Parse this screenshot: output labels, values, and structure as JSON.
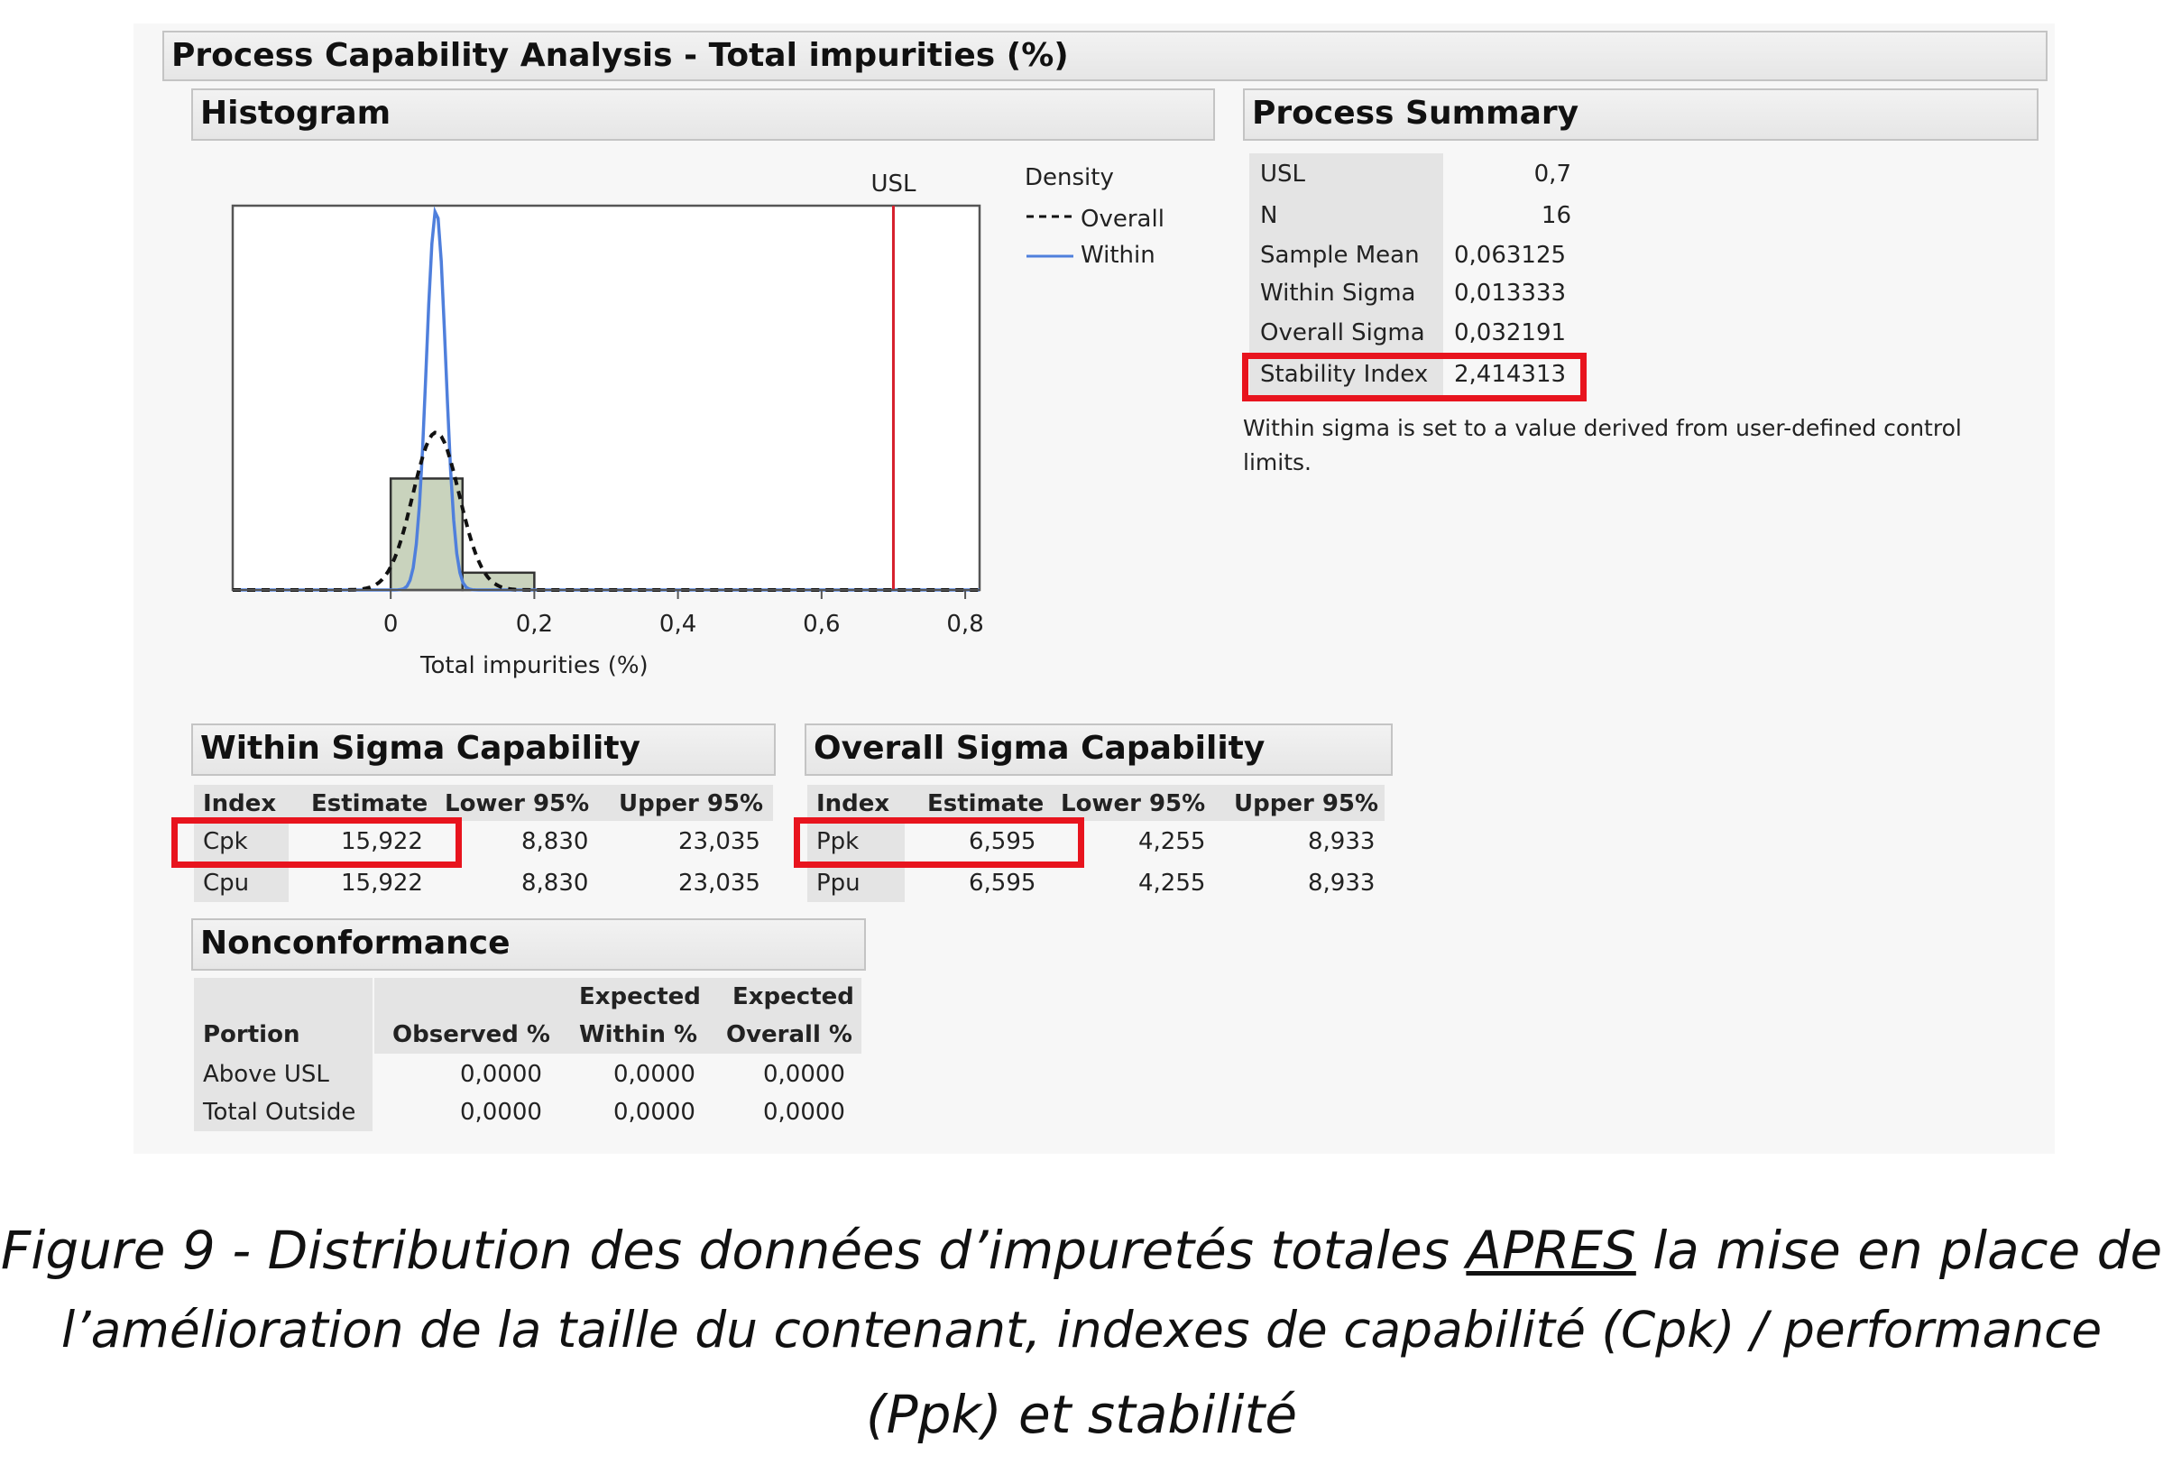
{
  "window_title": "Process Capability Analysis - Total impurities (%)",
  "histogram": {
    "title": "Histogram"
  },
  "chart_data": {
    "type": "bar",
    "title": "",
    "xlabel": "Total impurities (%)",
    "ylabel": "",
    "xlim": [
      -0.22,
      0.82
    ],
    "x_ticks": [
      "0",
      "0,2",
      "0,4",
      "0,6",
      "0,8"
    ],
    "x_tick_values": [
      0,
      0.2,
      0.4,
      0.6,
      0.8
    ],
    "bins": [
      {
        "x0": 0.0,
        "x1": 0.1,
        "relative_height": 0.29
      },
      {
        "x0": 0.1,
        "x1": 0.2,
        "relative_height": 0.045
      }
    ],
    "usl": {
      "label": "USL",
      "value": 0.7
    },
    "legend": {
      "title": "Density",
      "entries": [
        {
          "label": "Overall",
          "style": "dashed",
          "color": "#111111"
        },
        {
          "label": "Within",
          "style": "solid",
          "color": "#4f7fdc"
        }
      ],
      "placement": "right"
    },
    "density_overall": {
      "mean": 0.063125,
      "sigma": 0.032191,
      "peak_relative": 0.41
    },
    "density_within": {
      "mean": 0.063125,
      "sigma": 0.013333,
      "peak_relative": 0.99
    },
    "colors": {
      "bar_fill": "#c9d3bd",
      "bar_stroke": "#333333",
      "usl_line": "#d6202c"
    }
  },
  "process_summary": {
    "title": "Process Summary",
    "rows": [
      {
        "label": "USL",
        "value": "0,7"
      },
      {
        "label": "N",
        "value": "16"
      },
      {
        "label": "Sample Mean",
        "value": "0,063125"
      },
      {
        "label": "Within Sigma",
        "value": "0,013333"
      },
      {
        "label": "Overall Sigma",
        "value": "0,032191"
      },
      {
        "label": "Stability Index",
        "value": "2,414313"
      }
    ],
    "note_line1": "Within sigma is set to a value derived from user-defined control",
    "note_line2": "limits."
  },
  "within_capability": {
    "title": "Within Sigma Capability",
    "headers": [
      "Index",
      "Estimate",
      "Lower 95%",
      "Upper 95%"
    ],
    "rows": [
      [
        "Cpk",
        "15,922",
        "8,830",
        "23,035"
      ],
      [
        "Cpu",
        "15,922",
        "8,830",
        "23,035"
      ]
    ]
  },
  "overall_capability": {
    "title": "Overall Sigma Capability",
    "headers": [
      "Index",
      "Estimate",
      "Lower 95%",
      "Upper 95%"
    ],
    "rows": [
      [
        "Ppk",
        "6,595",
        "4,255",
        "8,933"
      ],
      [
        "Ppu",
        "6,595",
        "4,255",
        "8,933"
      ]
    ]
  },
  "nonconformance": {
    "title": "Nonconformance",
    "headers": {
      "portion": "Portion",
      "observed": "Observed %",
      "expected_within_1": "Expected",
      "expected_within_2": "Within %",
      "expected_overall_1": "Expected",
      "expected_overall_2": "Overall %"
    },
    "rows": [
      [
        "Above USL",
        "0,0000",
        "0,0000",
        "0,0000"
      ],
      [
        "Total Outside",
        "0,0000",
        "0,0000",
        "0,0000"
      ]
    ]
  },
  "caption": {
    "line1_pre": "Figure 9 - Distribution des données d’impuretés totales ",
    "line1_underlined": "APRES",
    "line1_post": " la mise en place de",
    "line2": "l’amélioration de la taille du contenant, indexes de capabilité (Cpk) / performance",
    "line3": "(Ppk) et stabilité"
  },
  "highlight_color": "#e8141e"
}
